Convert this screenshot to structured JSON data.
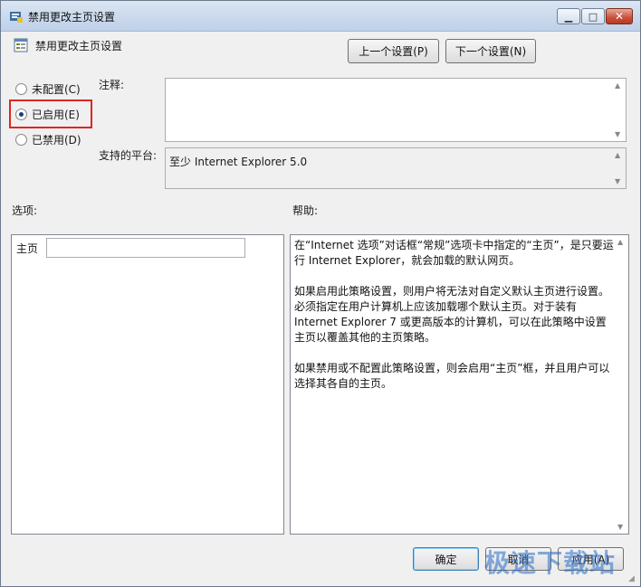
{
  "window": {
    "title": "禁用更改主页设置",
    "policy_name": "禁用更改主页设置",
    "controls": {
      "minimize": "▭",
      "maximize": "□",
      "close": "✕"
    }
  },
  "nav": {
    "prev_label": "上一个设置(P)",
    "next_label": "下一个设置(N)"
  },
  "state": {
    "options": [
      {
        "label": "未配置(C)",
        "checked": false
      },
      {
        "label": "已启用(E)",
        "checked": true
      },
      {
        "label": "已禁用(D)",
        "checked": false
      }
    ]
  },
  "comment": {
    "label": "注释:",
    "value": ""
  },
  "platform": {
    "label": "支持的平台:",
    "value": "至少 Internet Explorer 5.0"
  },
  "options_section": {
    "label": "选项:",
    "homepage_label": "主页",
    "homepage_value": ""
  },
  "help_section": {
    "label": "帮助:",
    "paragraphs": [
      "在“Internet 选项”对话框“常规”选项卡中指定的“主页”，是只要运行 Internet Explorer，就会加载的默认网页。",
      "如果启用此策略设置，则用户将无法对自定义默认主页进行设置。必须指定在用户计算机上应该加载哪个默认主页。对于装有 Internet Explorer 7 或更高版本的计算机，可以在此策略中设置主页以覆盖其他的主页策略。",
      "如果禁用或不配置此策略设置，则会启用“主页”框，并且用户可以选择其各自的主页。"
    ]
  },
  "footer": {
    "ok_label": "确定",
    "cancel_label": "取消",
    "apply_label": "应用(A)"
  },
  "watermark": "极速下载站",
  "colors": {
    "highlight_box": "#e02424",
    "titlebar": "#c9d8ec",
    "close_button": "#c8503a"
  }
}
